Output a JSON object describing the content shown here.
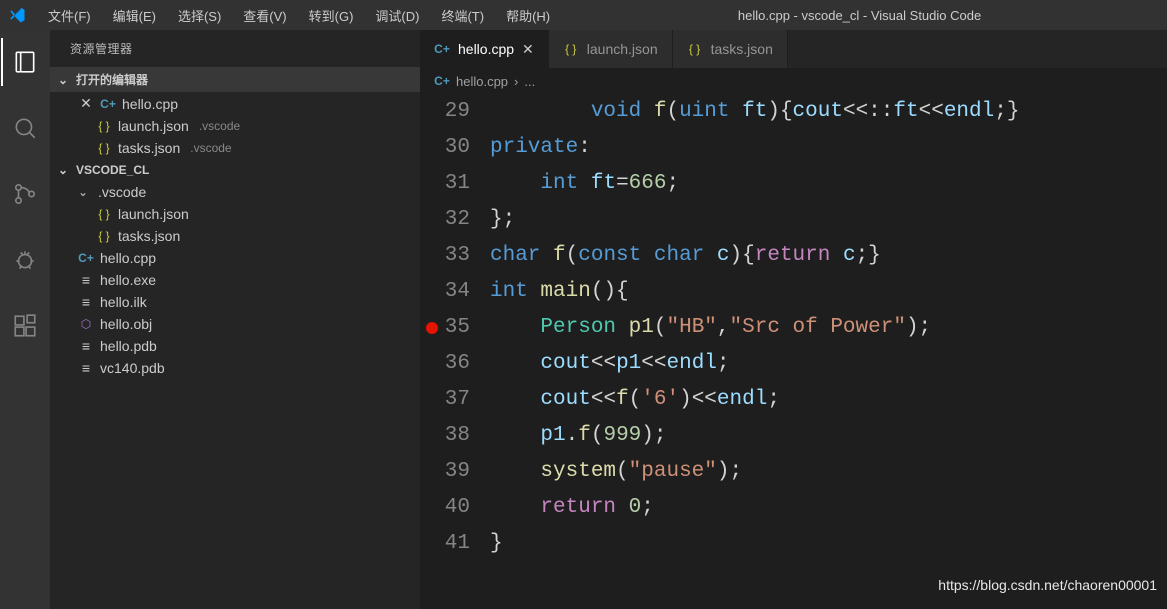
{
  "title": "hello.cpp - vscode_cl - Visual Studio Code",
  "menu": [
    "文件(F)",
    "编辑(E)",
    "选择(S)",
    "查看(V)",
    "转到(G)",
    "调试(D)",
    "终端(T)",
    "帮助(H)"
  ],
  "sidebar": {
    "title": "资源管理器",
    "sections": {
      "openEditors": {
        "label": "打开的编辑器",
        "items": [
          {
            "name": "hello.cpp",
            "icon": "cpp",
            "close": true
          },
          {
            "name": "launch.json",
            "icon": "json",
            "dir": ".vscode"
          },
          {
            "name": "tasks.json",
            "icon": "json",
            "dir": ".vscode"
          }
        ]
      },
      "workspace": {
        "label": "VSCODE_CL",
        "folders": [
          {
            "name": ".vscode",
            "items": [
              {
                "name": "launch.json",
                "icon": "json"
              },
              {
                "name": "tasks.json",
                "icon": "json"
              }
            ]
          }
        ],
        "files": [
          {
            "name": "hello.cpp",
            "icon": "cpp"
          },
          {
            "name": "hello.exe",
            "icon": "file"
          },
          {
            "name": "hello.ilk",
            "icon": "file"
          },
          {
            "name": "hello.obj",
            "icon": "obj"
          },
          {
            "name": "hello.pdb",
            "icon": "file"
          },
          {
            "name": "vc140.pdb",
            "icon": "file"
          }
        ]
      }
    }
  },
  "tabs": [
    {
      "name": "hello.cpp",
      "icon": "cpp",
      "active": true,
      "close": true
    },
    {
      "name": "launch.json",
      "icon": "json",
      "active": false
    },
    {
      "name": "tasks.json",
      "icon": "json",
      "active": false
    }
  ],
  "breadcrumb": {
    "file": "hello.cpp",
    "sep": "›",
    "more": "..."
  },
  "code": {
    "startLine": 29,
    "breakpointLine": 35,
    "lines": [
      [
        [
          "",
          "        "
        ],
        [
          "kw",
          "void"
        ],
        [
          "",
          " "
        ],
        [
          "fn",
          "f"
        ],
        [
          "",
          "("
        ],
        [
          "kw",
          "uint"
        ],
        [
          "",
          " "
        ],
        [
          "param",
          "ft"
        ],
        [
          "",
          ")"
        ],
        [
          "",
          "{"
        ],
        [
          "param",
          "cout"
        ],
        [
          "",
          "<<::"
        ],
        [
          "param",
          "ft"
        ],
        [
          "",
          "<<"
        ],
        [
          "param",
          "endl"
        ],
        [
          "",
          ";}"
        ]
      ],
      [
        [
          "kw",
          "private"
        ],
        [
          "",
          ":"
        ]
      ],
      [
        [
          "",
          "    "
        ],
        [
          "kw",
          "int"
        ],
        [
          "",
          " "
        ],
        [
          "param",
          "ft"
        ],
        [
          "",
          "="
        ],
        [
          "num",
          "666"
        ],
        [
          "",
          ";"
        ]
      ],
      [
        [
          "",
          "};"
        ]
      ],
      [
        [
          "kw",
          "char"
        ],
        [
          "",
          " "
        ],
        [
          "fn",
          "f"
        ],
        [
          "",
          "("
        ],
        [
          "kw",
          "const"
        ],
        [
          "",
          " "
        ],
        [
          "kw",
          "char"
        ],
        [
          "",
          " "
        ],
        [
          "param",
          "c"
        ],
        [
          "",
          "){"
        ],
        [
          "ctrl",
          "return"
        ],
        [
          "",
          " "
        ],
        [
          "param",
          "c"
        ],
        [
          "",
          ";}"
        ]
      ],
      [
        [
          "kw",
          "int"
        ],
        [
          "",
          " "
        ],
        [
          "fn",
          "main"
        ],
        [
          "",
          "(){"
        ]
      ],
      [
        [
          "",
          "    "
        ],
        [
          "type",
          "Person"
        ],
        [
          "",
          " "
        ],
        [
          "fn",
          "p1"
        ],
        [
          "",
          "("
        ],
        [
          "str",
          "\"HB\""
        ],
        [
          "",
          ","
        ],
        [
          "str",
          "\"Src of Power\""
        ],
        [
          "",
          ");"
        ]
      ],
      [
        [
          "",
          "    "
        ],
        [
          "param",
          "cout"
        ],
        [
          "",
          "<<"
        ],
        [
          "param",
          "p1"
        ],
        [
          "",
          "<<"
        ],
        [
          "param",
          "endl"
        ],
        [
          "",
          ";"
        ]
      ],
      [
        [
          "",
          "    "
        ],
        [
          "param",
          "cout"
        ],
        [
          "",
          "<<"
        ],
        [
          "fn",
          "f"
        ],
        [
          "",
          "("
        ],
        [
          "str",
          "'6'"
        ],
        [
          "",
          ")<<"
        ],
        [
          "param",
          "endl"
        ],
        [
          "",
          ";"
        ]
      ],
      [
        [
          "",
          "    "
        ],
        [
          "param",
          "p1"
        ],
        [
          "",
          "."
        ],
        [
          "fn",
          "f"
        ],
        [
          "",
          "("
        ],
        [
          "num",
          "999"
        ],
        [
          "",
          ");"
        ]
      ],
      [
        [
          "",
          "    "
        ],
        [
          "fn",
          "system"
        ],
        [
          "",
          "("
        ],
        [
          "str",
          "\"pause\""
        ],
        [
          "",
          ");"
        ]
      ],
      [
        [
          "",
          "    "
        ],
        [
          "ctrl",
          "return"
        ],
        [
          "",
          " "
        ],
        [
          "num",
          "0"
        ],
        [
          "",
          ";"
        ]
      ],
      [
        [
          "",
          "}"
        ]
      ]
    ]
  },
  "watermark": "https://blog.csdn.net/chaoren00001"
}
